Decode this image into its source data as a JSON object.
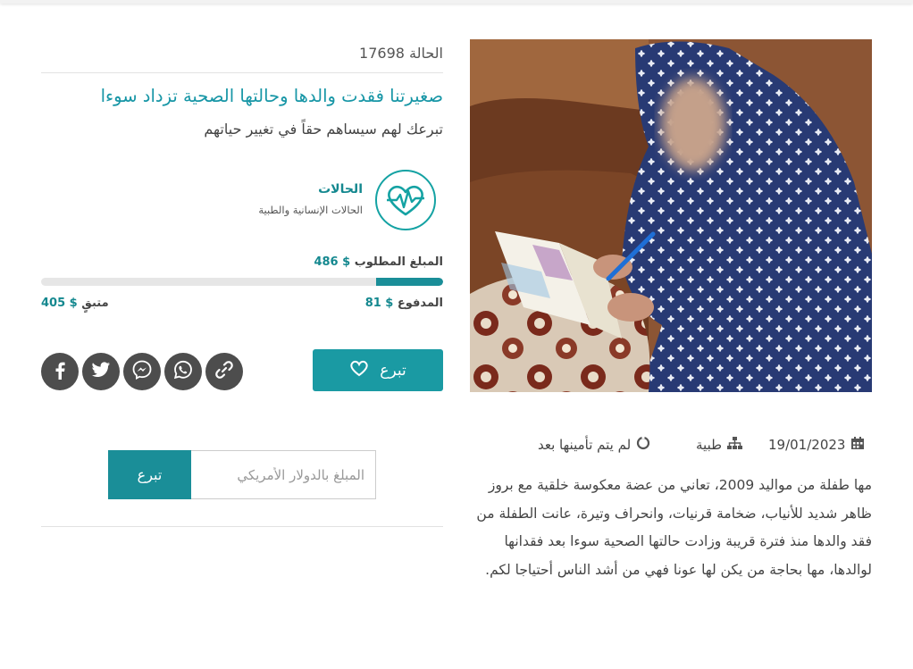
{
  "case": {
    "number_label": "الحالة 17698",
    "title": "صغيرتنا فقدت والدها وحالتها الصحية تزداد سوءا",
    "subtitle": "تبرعك لهم سيساهم حقاً في تغيير حياتهم"
  },
  "category": {
    "name": "الحالات",
    "description": "الحالات الإنسانية والطبية",
    "icon": "heart-pulse-icon"
  },
  "funding": {
    "required_label": "المبلغ المطلوب",
    "required_value": "486 $",
    "paid_label": "المدفوع",
    "paid_value": "81 $",
    "remaining_label": "متبقٍ",
    "remaining_value": "405 $",
    "progress_fraction": 0.167
  },
  "actions": {
    "donate_label": "تبرع",
    "amount_placeholder": "المبلغ بالدولار الأمريكي",
    "amount_button": "تبرع"
  },
  "share": [
    "link-icon",
    "whatsapp-icon",
    "messenger-icon",
    "twitter-icon",
    "facebook-icon"
  ],
  "meta": {
    "date": "19/01/2023",
    "category": "طبية",
    "insurance_status": "لم يتم تأمينها بعد"
  },
  "story": "مها طفلة من مواليد 2009، تعاني من عضة معكوسة خلقية مع بروز ظاهر شديد للأنياب، ضخامة قرنيات، وانحراف وتيرة، عانت الطفلة من فقد والدها منذ فترة قريبة وزادت حالتها الصحية سوءا بعد فقدانها لوالدها، مها بحاجة من يكن لها عونا فهي من أشد الناس أحتياجا لكم.",
  "colors": {
    "accent": "#1a9aa3",
    "accent_dark": "#14888f",
    "title": "#1796a6",
    "share": "#4d4d4d"
  }
}
